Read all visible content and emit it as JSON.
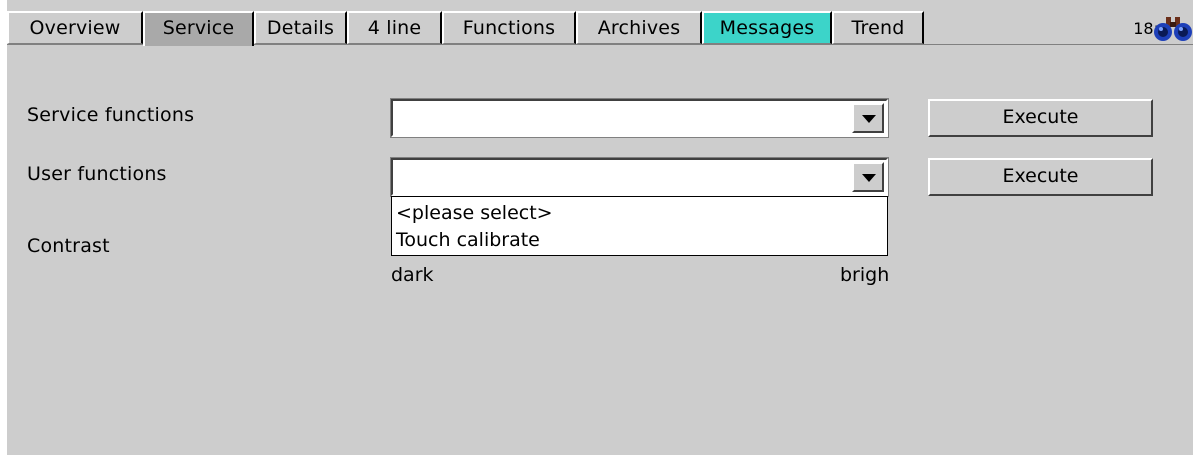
{
  "tabs": [
    {
      "label": "Overview",
      "state": "normal"
    },
    {
      "label": "Service",
      "state": "active"
    },
    {
      "label": "Details",
      "state": "normal"
    },
    {
      "label": "4 line",
      "state": "normal"
    },
    {
      "label": "Functions",
      "state": "normal"
    },
    {
      "label": "Archives",
      "state": "normal"
    },
    {
      "label": "Messages",
      "state": "alarm"
    },
    {
      "label": "Trend",
      "state": "normal"
    }
  ],
  "status": {
    "clock": "18:",
    "icon": "binoculars-icon"
  },
  "service_functions": {
    "label": "Service functions",
    "value": "",
    "execute_label": "Execute"
  },
  "user_functions": {
    "label": "User functions",
    "value": "",
    "execute_label": "Execute",
    "options": [
      "<please select>",
      "Touch calibrate"
    ]
  },
  "contrast": {
    "label": "Contrast",
    "min_label": "dark",
    "max_label": "brigh"
  },
  "colors": {
    "background": "#cdcdcd",
    "active_tab": "#a9a9a9",
    "alarm_tab": "#3cd4c9"
  }
}
